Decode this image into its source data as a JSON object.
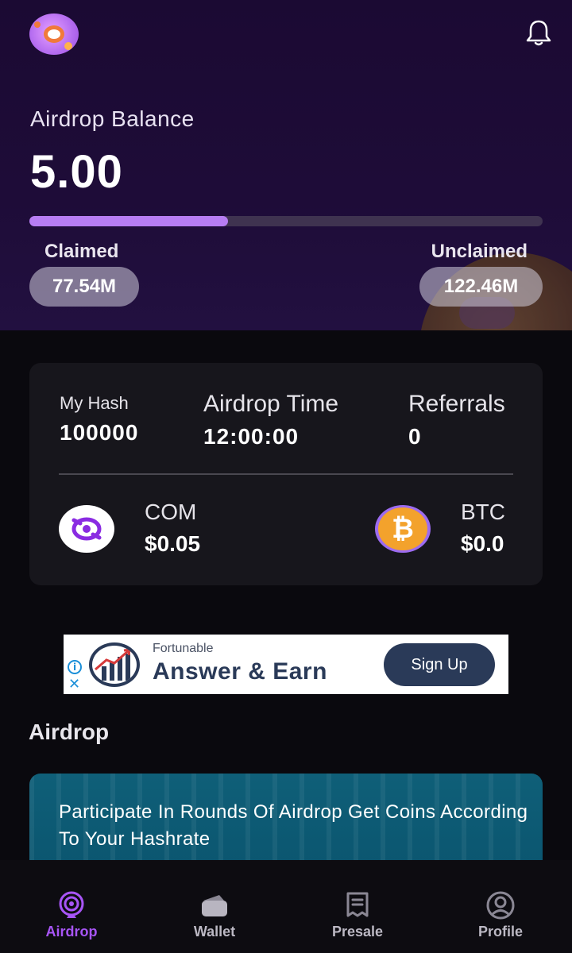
{
  "header": {
    "logo_icon": "app-logo",
    "notification_icon": "bell-icon"
  },
  "balance": {
    "label": "Airdrop Balance",
    "value": "5.00",
    "progress_fraction": 0.387,
    "claimed_label": "Claimed",
    "claimed_value": "77.54M",
    "unclaimed_label": "Unclaimed",
    "unclaimed_value": "122.46M"
  },
  "stats": {
    "hash_label": "My Hash",
    "hash_value": "100000",
    "time_label": "Airdrop Time",
    "time_value": "12:00:00",
    "referrals_label": "Referrals",
    "referrals_value": "0"
  },
  "coins": {
    "com_label": "COM",
    "com_value": "$0.05",
    "btc_label": "BTC",
    "btc_value": "$0.0",
    "btc_symbol": "₿"
  },
  "ad": {
    "brand": "Fortunable",
    "headline": "Answer & Earn",
    "cta": "Sign Up",
    "info_glyph": "i",
    "close_glyph": "✕"
  },
  "airdrop_section": {
    "title": "Airdrop",
    "banner_text": "Participate In Rounds Of Airdrop Get Coins According To Your Hashrate"
  },
  "tabs": [
    {
      "label": "Airdrop",
      "icon": "airdrop-icon",
      "active": true
    },
    {
      "label": "Wallet",
      "icon": "wallet-icon",
      "active": false
    },
    {
      "label": "Presale",
      "icon": "receipt-icon",
      "active": false
    },
    {
      "label": "Profile",
      "icon": "user-icon",
      "active": false
    }
  ],
  "colors": {
    "accent": "#a855f7",
    "progress_fill": "#b77df3",
    "hero_bg": "#1e0c38",
    "btc_orange": "#f3a22c"
  }
}
